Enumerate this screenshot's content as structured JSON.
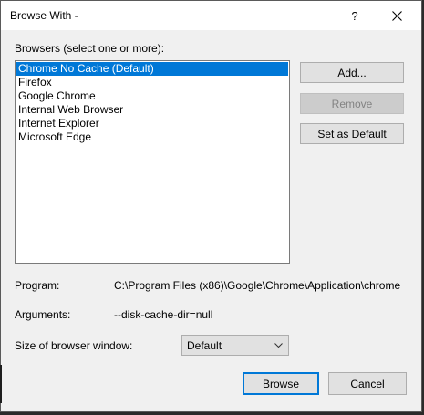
{
  "window": {
    "title": "Browse With -",
    "help_label": "?"
  },
  "browsers": {
    "label": "Browsers (select one or more):",
    "items": [
      {
        "label": "Chrome No Cache (Default)",
        "selected": true
      },
      {
        "label": "Firefox",
        "selected": false
      },
      {
        "label": "Google Chrome",
        "selected": false
      },
      {
        "label": "Internal Web Browser",
        "selected": false
      },
      {
        "label": "Internet Explorer",
        "selected": false
      },
      {
        "label": "Microsoft Edge",
        "selected": false
      }
    ]
  },
  "actions": {
    "add_label": "Add...",
    "remove_label": "Remove",
    "set_default_label": "Set as Default"
  },
  "details": {
    "program_label": "Program:",
    "program_value": "C:\\Program Files (x86)\\Google\\Chrome\\Application\\chrome",
    "arguments_label": "Arguments:",
    "arguments_value": "--disk-cache-dir=null",
    "window_size_label": "Size of browser window:",
    "window_size_value": "Default"
  },
  "footer": {
    "browse_label": "Browse",
    "cancel_label": "Cancel"
  },
  "colors": {
    "selection": "#0078d7",
    "dialog_bg": "#f0f0f0"
  }
}
